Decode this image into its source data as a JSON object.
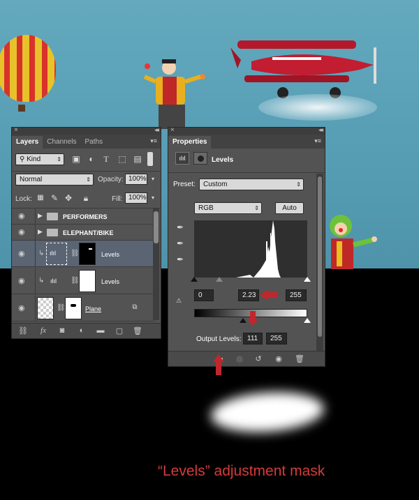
{
  "layers_panel": {
    "tabs": [
      "Layers",
      "Channels",
      "Paths"
    ],
    "filter_kind": "Kind",
    "blend_mode": "Normal",
    "opacity_label": "Opacity:",
    "opacity_value": "100%",
    "lock_label": "Lock:",
    "fill_label": "Fill:",
    "fill_value": "100%",
    "layers": [
      {
        "name": "PERFORMERS",
        "type": "group"
      },
      {
        "name": "ELEPHANT/BIKE",
        "type": "group"
      },
      {
        "name": "Levels",
        "type": "adjustment",
        "selected": true
      },
      {
        "name": "Levels",
        "type": "adjustment",
        "selected": false
      },
      {
        "name": "Plane",
        "type": "pixel"
      }
    ],
    "bottom_icons": [
      "link-icon",
      "fx-icon",
      "mask-icon",
      "adjustment-icon",
      "group-icon",
      "new-layer-icon",
      "trash-icon"
    ],
    "fx_label": "fx"
  },
  "properties_panel": {
    "tab": "Properties",
    "title": "Levels",
    "preset_label": "Preset:",
    "preset_value": "Custom",
    "channel_value": "RGB",
    "auto_button": "Auto",
    "input_black": "0",
    "input_gamma": "2.23",
    "input_white": "255",
    "output_label": "Output Levels:",
    "output_black": "111",
    "output_white": "255",
    "annotation_color": "#c0272d"
  },
  "caption": "“Levels” adjustment mask"
}
